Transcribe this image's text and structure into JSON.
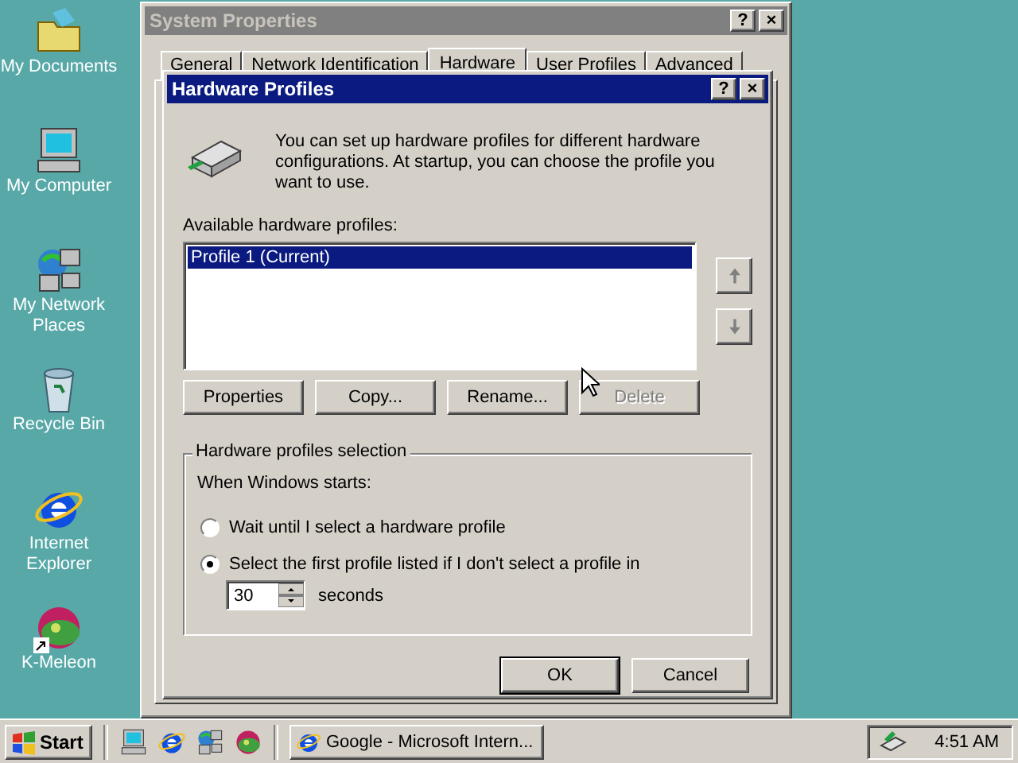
{
  "desktop": {
    "icons": [
      {
        "kind": "documents",
        "label": "My Documents"
      },
      {
        "kind": "computer",
        "label": "My Computer"
      },
      {
        "kind": "network",
        "label": "My Network Places"
      },
      {
        "kind": "recycle",
        "label": "Recycle Bin"
      },
      {
        "kind": "browser",
        "label": "Internet Explorer"
      },
      {
        "kind": "meleon",
        "label": "K-Meleon",
        "shortcut": true
      }
    ]
  },
  "background_window": {
    "title": "System Properties",
    "title_buttons": [
      "?",
      "×"
    ],
    "tabs": [
      {
        "label": "General",
        "selected": false
      },
      {
        "label": "Network Identification",
        "selected": false
      },
      {
        "label": "Hardware",
        "selected": true
      },
      {
        "label": "User Profiles",
        "selected": false
      },
      {
        "label": "Advanced",
        "selected": false
      }
    ]
  },
  "dialog": {
    "title": "Hardware Profiles",
    "title_buttons": [
      "?",
      "×"
    ],
    "description": "You can set up hardware profiles for different hardware configurations.  At startup, you can choose the profile you want to use.",
    "list_label": "Available hardware profiles:",
    "profiles": [
      {
        "label": "Profile 1 (Current)",
        "selected": true
      }
    ],
    "move_buttons": [
      {
        "kind": "up",
        "disabled": true
      },
      {
        "kind": "down",
        "disabled": true
      }
    ],
    "buttons": [
      {
        "label": "Properties",
        "disabled": false
      },
      {
        "label": "Copy...",
        "disabled": false
      },
      {
        "label": "Rename...",
        "disabled": false
      },
      {
        "label": "Delete",
        "disabled": true
      }
    ],
    "selection": {
      "title": "Hardware profiles selection",
      "prompt": "When Windows starts:",
      "options": [
        {
          "label": "Wait until I select a hardware profile",
          "selected": false
        },
        {
          "label": "Select the first profile listed if I don't select a profile in",
          "selected": true
        }
      ],
      "timeout": {
        "value": "30",
        "unit": "seconds"
      }
    },
    "footer_buttons": [
      {
        "label": "OK",
        "default": true
      },
      {
        "label": "Cancel",
        "default": false
      }
    ]
  },
  "taskbar": {
    "start": "Start",
    "quick_launch": [
      {
        "kind": "desktop"
      },
      {
        "kind": "browser"
      },
      {
        "kind": "network"
      },
      {
        "kind": "meleon"
      }
    ],
    "tasks": [
      {
        "label": "Google - Microsoft Intern...",
        "selected": false
      }
    ],
    "clock": "4:51 AM"
  }
}
